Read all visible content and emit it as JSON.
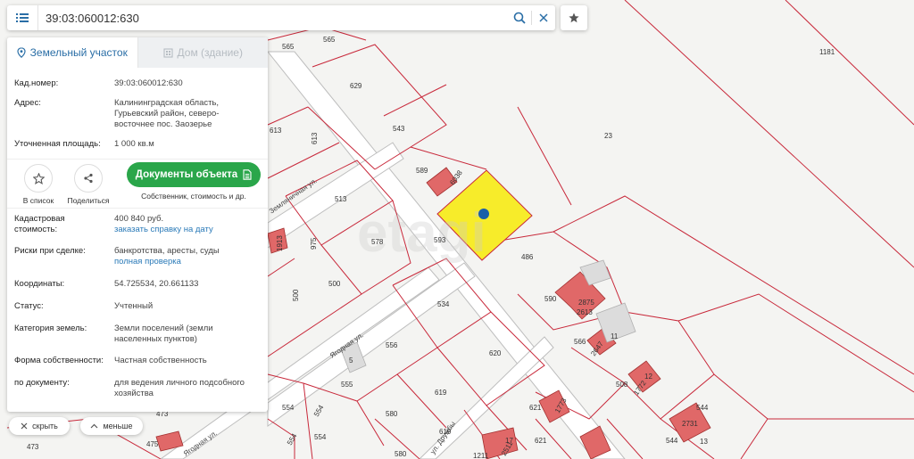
{
  "search": {
    "value": "39:03:060012:630"
  },
  "tabs": {
    "land": "Земельный участок",
    "house": "Дом (здание)"
  },
  "info": {
    "cad_label": "Кад.номер:",
    "cad_value": "39:03:060012:630",
    "addr_label": "Адрес:",
    "addr_lines": [
      "Калининградская область,",
      "Гурьевский район, северо-",
      "восточнее пос. Заозерье"
    ],
    "area_label": "Уточненная площадь:",
    "area_value": "1 000 кв.м"
  },
  "actions": {
    "list_label": "В список",
    "share_label": "Поделиться",
    "docs_label": "Документы объекта",
    "docs_sub": "Собственник, стоимость и др."
  },
  "details": {
    "cost_label_1": "Кадастровая",
    "cost_label_2": "стоимость:",
    "cost_value": "400 840 руб.",
    "cost_link": "заказать справку на дату",
    "risk_label": "Риски при сделке:",
    "risk_value": "банкротства, аресты, суды",
    "risk_link": "полная проверка",
    "coord_label": "Координаты:",
    "coord_value": "54.725534, 20.661133",
    "status_label": "Статус:",
    "status_value": "Учтенный",
    "category_label": "Категория земель:",
    "category_lines": [
      "Земли поселений (земли",
      "населенных пунктов)"
    ],
    "ownership_label": "Форма собственности:",
    "ownership_value": "Частная собственность",
    "doc_label": "по документу:",
    "doc_lines": [
      "для ведения личного подсобного",
      "хозяйства"
    ]
  },
  "bottom": {
    "hide_label": "скрыть",
    "less_label": "меньше"
  },
  "map": {
    "watermark": "etagi",
    "streets": {
      "zemlyanichnaya": "Земляничная ул.",
      "yagodnaya": "Ягодная ул.",
      "yagodnaya2": "Ягодная ул.",
      "druzhby": "ул. Дружбы"
    },
    "parcels": {
      "p565a": "565",
      "p565b": "565",
      "p629": "629",
      "p543": "543",
      "p613a": "613",
      "p613b": "613",
      "p589": "589",
      "p6038": "6038",
      "p513": "513",
      "p578": "578",
      "p593": "593",
      "p975": "975",
      "p500": "500",
      "p500b": "500",
      "p534": "534",
      "p486": "486",
      "p590": "590",
      "p2875": "2875",
      "p2613": "2613",
      "p556": "556",
      "p620": "620",
      "p566": "566",
      "p11": "11",
      "p5": "5",
      "p555": "555",
      "p619": "619",
      "p508": "508",
      "p12": "12",
      "p554a": "554",
      "p554b": "554",
      "p554c": "554",
      "p580": "580",
      "p621a": "621",
      "p621b": "621",
      "p1773": "1773",
      "p619b": "619",
      "p544a": "544",
      "p544b": "544",
      "p473a": "473",
      "p473b": "473",
      "p475": "475",
      "p1181": "1181",
      "p23": "23",
      "p13": "13",
      "p1211": "1211",
      "p2731": "2731",
      "p2511": "2511",
      "p17": "17",
      "p1913": "1913",
      "p2647": "2647",
      "p1772": "1772",
      "p580b": "580"
    }
  },
  "colors": {
    "accent": "#2a6ea6",
    "boundary": "#c8283a",
    "selected": "#f7ec2a",
    "marker": "#1a5fa8",
    "button": "#2aa64a"
  }
}
